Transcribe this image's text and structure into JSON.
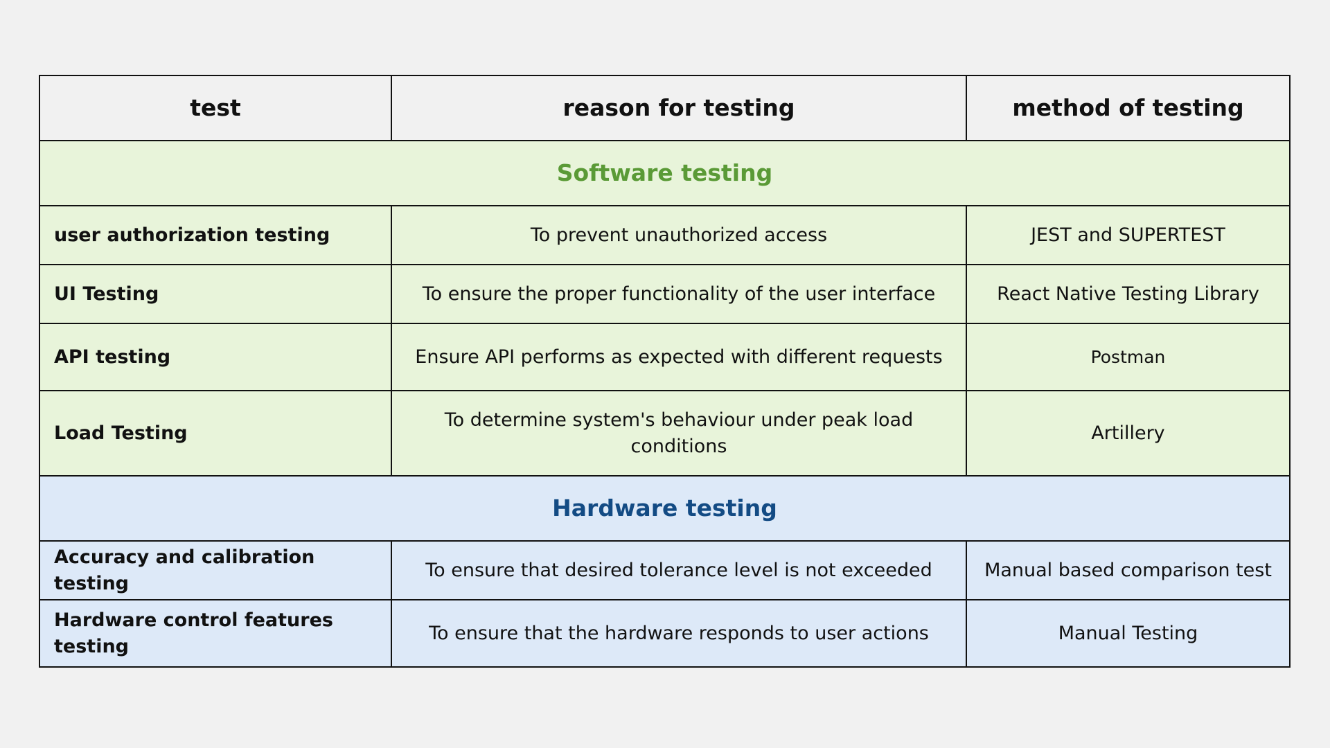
{
  "headers": {
    "test": "test",
    "reason": "reason for testing",
    "method": "method of testing"
  },
  "software": {
    "title": "Software testing",
    "rows": [
      {
        "test": "user authorization testing",
        "reason": "To prevent unauthorized access",
        "method": "JEST and SUPERTEST"
      },
      {
        "test": "UI Testing",
        "reason": "To ensure the proper functionality of the user interface",
        "method": "React Native Testing Library"
      },
      {
        "test": "API testing",
        "reason": "Ensure API performs as expected with different requests",
        "method": "Postman"
      },
      {
        "test": "Load Testing",
        "reason": "To determine system's behaviour under peak load conditions",
        "method": "Artillery"
      }
    ]
  },
  "hardware": {
    "title": "Hardware testing",
    "rows": [
      {
        "test": "Accuracy and calibration testing",
        "reason": "To ensure that desired tolerance level is not exceeded",
        "method": "Manual based comparison test"
      },
      {
        "test": "Hardware control features testing",
        "reason": "To ensure that the hardware responds to user actions",
        "method": "Manual Testing"
      }
    ]
  },
  "colors": {
    "background": "#f1f1f1",
    "software_fill": "#e8f4da",
    "software_title": "#5a9a36",
    "hardware_fill": "#dde9f8",
    "hardware_title": "#134b84"
  }
}
